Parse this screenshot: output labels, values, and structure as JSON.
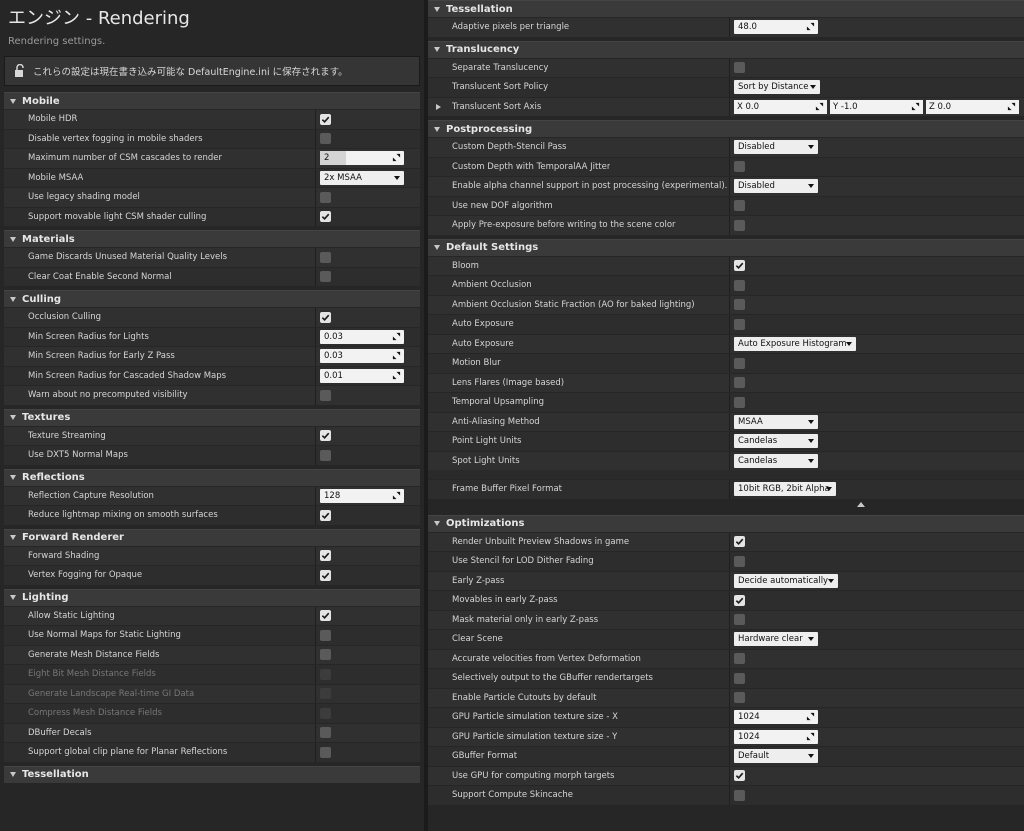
{
  "header": {
    "title": "エンジン - Rendering",
    "subtitle": "Rendering settings."
  },
  "notice": {
    "text": "これらの設定は現在書き込み可能な DefaultEngine.ini に保存されます。",
    "icon": "unlock-icon"
  },
  "left_sections": [
    {
      "title": "Mobile",
      "rows": [
        {
          "label": "Mobile HDR",
          "type": "checkbox",
          "checked": true
        },
        {
          "label": "Disable vertex fogging in mobile shaders",
          "type": "checkbox",
          "checked": false
        },
        {
          "label": "Maximum number of CSM cascades to render",
          "type": "number",
          "value": "2",
          "slider": true
        },
        {
          "label": "Mobile MSAA",
          "type": "dropdown",
          "value": "2x MSAA",
          "w": 84
        },
        {
          "label": "Use legacy shading model",
          "type": "checkbox",
          "checked": false
        },
        {
          "label": "Support movable light CSM shader culling",
          "type": "checkbox",
          "checked": true
        }
      ]
    },
    {
      "title": "Materials",
      "rows": [
        {
          "label": "Game Discards Unused Material Quality Levels",
          "type": "checkbox",
          "checked": false
        },
        {
          "label": "Clear Coat Enable Second Normal",
          "type": "checkbox",
          "checked": false
        }
      ]
    },
    {
      "title": "Culling",
      "rows": [
        {
          "label": "Occlusion Culling",
          "type": "checkbox",
          "checked": true
        },
        {
          "label": "Min Screen Radius for Lights",
          "type": "number",
          "value": "0.03"
        },
        {
          "label": "Min Screen Radius for Early Z Pass",
          "type": "number",
          "value": "0.03"
        },
        {
          "label": "Min Screen Radius for Cascaded Shadow Maps",
          "type": "number",
          "value": "0.01"
        },
        {
          "label": "Warn about no precomputed visibility",
          "type": "checkbox",
          "checked": false
        }
      ]
    },
    {
      "title": "Textures",
      "rows": [
        {
          "label": "Texture Streaming",
          "type": "checkbox",
          "checked": true
        },
        {
          "label": "Use DXT5 Normal Maps",
          "type": "checkbox",
          "checked": false
        }
      ]
    },
    {
      "title": "Reflections",
      "rows": [
        {
          "label": "Reflection Capture Resolution",
          "type": "number",
          "value": "128"
        },
        {
          "label": "Reduce lightmap mixing on smooth surfaces",
          "type": "checkbox",
          "checked": true
        }
      ]
    },
    {
      "title": "Forward Renderer",
      "rows": [
        {
          "label": "Forward Shading",
          "type": "checkbox",
          "checked": true
        },
        {
          "label": "Vertex Fogging for Opaque",
          "type": "checkbox",
          "checked": true
        }
      ]
    },
    {
      "title": "Lighting",
      "rows": [
        {
          "label": "Allow Static Lighting",
          "type": "checkbox",
          "checked": true
        },
        {
          "label": "Use Normal Maps for Static Lighting",
          "type": "checkbox",
          "checked": false
        },
        {
          "label": "Generate Mesh Distance Fields",
          "type": "checkbox",
          "checked": false
        },
        {
          "label": "Eight Bit Mesh Distance Fields",
          "type": "checkbox",
          "checked": false,
          "disabled": true
        },
        {
          "label": "Generate Landscape Real-time GI Data",
          "type": "checkbox",
          "checked": false,
          "disabled": true
        },
        {
          "label": "Compress Mesh Distance Fields",
          "type": "checkbox",
          "checked": false,
          "disabled": true
        },
        {
          "label": "DBuffer Decals",
          "type": "checkbox",
          "checked": false
        },
        {
          "label": "Support global clip plane for Planar Reflections",
          "type": "checkbox",
          "checked": false
        }
      ]
    },
    {
      "title": "Tessellation",
      "rows": []
    }
  ],
  "right_sections": [
    {
      "title": "Tessellation",
      "rows": [
        {
          "label": "Adaptive pixels per triangle",
          "type": "number",
          "value": "48.0"
        }
      ]
    },
    {
      "title": "Translucency",
      "rows": [
        {
          "label": "Separate Translucency",
          "type": "checkbox",
          "checked": false
        },
        {
          "label": "Translucent Sort Policy",
          "type": "dropdown",
          "value": "Sort by Distance",
          "w": 86
        },
        {
          "label": "Translucent Sort Axis",
          "type": "vector",
          "expandable": true,
          "x": "X  0.0",
          "y": "Y  -1.0",
          "z": "Z  0.0"
        }
      ]
    },
    {
      "title": "Postprocessing",
      "rows": [
        {
          "label": "Custom Depth-Stencil Pass",
          "type": "dropdown",
          "value": "Disabled",
          "w": 84
        },
        {
          "label": "Custom Depth with TemporalAA Jitter",
          "type": "checkbox",
          "checked": false
        },
        {
          "label": "Enable alpha channel support in post processing (experimental).",
          "type": "dropdown",
          "value": "Disabled",
          "w": 84
        },
        {
          "label": "Use new DOF algorithm",
          "type": "checkbox",
          "checked": false
        },
        {
          "label": "Apply Pre-exposure before writing to the scene color",
          "type": "checkbox",
          "checked": false
        }
      ]
    },
    {
      "title": "Default Settings",
      "rows": [
        {
          "label": "Bloom",
          "type": "checkbox",
          "checked": true
        },
        {
          "label": "Ambient Occlusion",
          "type": "checkbox",
          "checked": false
        },
        {
          "label": "Ambient Occlusion Static Fraction (AO for baked lighting)",
          "type": "checkbox",
          "checked": false
        },
        {
          "label": "Auto Exposure",
          "type": "checkbox",
          "checked": false
        },
        {
          "label": "Auto Exposure",
          "type": "dropdown",
          "value": "Auto Exposure Histogram",
          "w": 122
        },
        {
          "label": "Motion Blur",
          "type": "checkbox",
          "checked": false
        },
        {
          "label": "Lens Flares (Image based)",
          "type": "checkbox",
          "checked": false
        },
        {
          "label": "Temporal Upsampling",
          "type": "checkbox",
          "checked": false
        },
        {
          "label": "Anti-Aliasing Method",
          "type": "dropdown",
          "value": "MSAA",
          "w": 84
        },
        {
          "label": "Point Light Units",
          "type": "dropdown",
          "value": "Candelas",
          "w": 84
        },
        {
          "label": "Spot Light Units",
          "type": "dropdown",
          "value": "Candelas",
          "w": 84
        },
        {
          "label": "Frame Buffer Pixel Format",
          "type": "dropdown",
          "value": "10bit RGB, 2bit Alpha",
          "w": 102,
          "advanced": true
        }
      ]
    },
    {
      "title": "Optimizations",
      "rows": [
        {
          "label": "Render Unbuilt Preview Shadows in game",
          "type": "checkbox",
          "checked": true
        },
        {
          "label": "Use Stencil for LOD Dither Fading",
          "type": "checkbox",
          "checked": false
        },
        {
          "label": "Early Z-pass",
          "type": "dropdown",
          "value": "Decide automatically",
          "w": 104
        },
        {
          "label": "Movables in early Z-pass",
          "type": "checkbox",
          "checked": true
        },
        {
          "label": "Mask material only in early Z-pass",
          "type": "checkbox",
          "checked": false
        },
        {
          "label": "Clear Scene",
          "type": "dropdown",
          "value": "Hardware clear",
          "w": 84
        },
        {
          "label": "Accurate velocities from Vertex Deformation",
          "type": "checkbox",
          "checked": false
        },
        {
          "label": "Selectively output to the GBuffer rendertargets",
          "type": "checkbox",
          "checked": false
        },
        {
          "label": "Enable Particle Cutouts by default",
          "type": "checkbox",
          "checked": false
        },
        {
          "label": "GPU Particle simulation texture size - X",
          "type": "number",
          "value": "1024"
        },
        {
          "label": "GPU Particle simulation texture size - Y",
          "type": "number",
          "value": "1024"
        },
        {
          "label": "GBuffer Format",
          "type": "dropdown",
          "value": "Default",
          "w": 84
        },
        {
          "label": "Use GPU for computing morph targets",
          "type": "checkbox",
          "checked": true
        },
        {
          "label": "Support Compute Skincache",
          "type": "checkbox",
          "checked": false
        }
      ]
    }
  ],
  "colors": {
    "panel": "#262626",
    "row": "#303030",
    "section_header": "#3a3a3a",
    "field": "#f2f2f2"
  }
}
